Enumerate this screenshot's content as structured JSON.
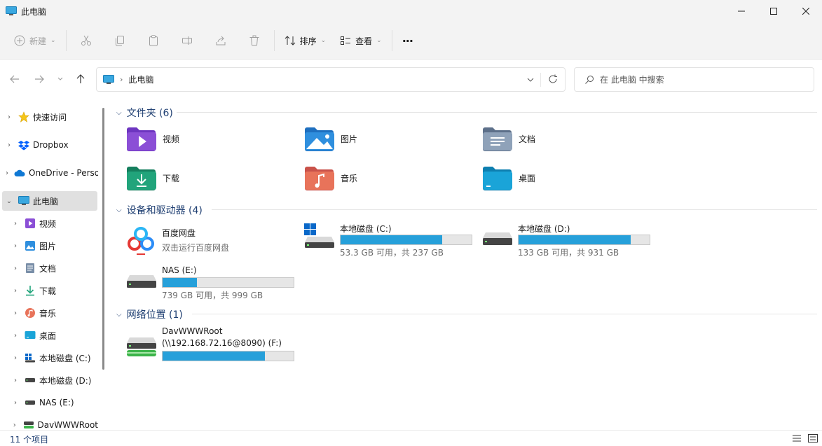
{
  "window": {
    "title": "此电脑"
  },
  "toolbar": {
    "new_label": "新建",
    "sort_label": "排序",
    "view_label": "查看",
    "more_label": "···"
  },
  "address": {
    "crumb": "此电脑",
    "search_placeholder": "在 此电脑 中搜索"
  },
  "sidebar": {
    "items": [
      {
        "label": "快速访问"
      },
      {
        "label": "Dropbox"
      },
      {
        "label": "OneDrive - Personal"
      },
      {
        "label": "此电脑"
      },
      {
        "label": "视频"
      },
      {
        "label": "图片"
      },
      {
        "label": "文档"
      },
      {
        "label": "下载"
      },
      {
        "label": "音乐"
      },
      {
        "label": "桌面"
      },
      {
        "label": "本地磁盘 (C:)"
      },
      {
        "label": "本地磁盘 (D:)"
      },
      {
        "label": "NAS (E:)"
      },
      {
        "label": "DavWWWRoot"
      }
    ]
  },
  "groups": {
    "folders": {
      "title": "文件夹 (6)"
    },
    "devices": {
      "title": "设备和驱动器 (4)"
    },
    "network": {
      "title": "网络位置 (1)"
    }
  },
  "folders": [
    {
      "name": "视频",
      "color": "#8b4fd6"
    },
    {
      "name": "图片",
      "color": "#2f8fde"
    },
    {
      "name": "文档",
      "color": "#7a8fa8"
    },
    {
      "name": "下载",
      "color": "#21a47b"
    },
    {
      "name": "音乐",
      "color": "#e8735a"
    },
    {
      "name": "桌面",
      "color": "#1aa4d8"
    }
  ],
  "baidu": {
    "name": "百度网盘",
    "subtitle": "双击运行百度网盘"
  },
  "drives": [
    {
      "name": "本地磁盘 (C:)",
      "free": "53.3 GB 可用，共 237 GB",
      "used_fraction": 0.775
    },
    {
      "name": "本地磁盘 (D:)",
      "free": "133 GB 可用，共 931 GB",
      "used_fraction": 0.857
    },
    {
      "name": "NAS (E:)",
      "free": "739 GB 可用，共 999 GB",
      "used_fraction": 0.26
    }
  ],
  "network_drive": {
    "name_line1": "DavWWWRoot",
    "name_line2": "(\\\\192.168.72.16@8090) (F:)",
    "used_fraction": 0.78
  },
  "status": {
    "count": "11 个项目"
  },
  "colors": {
    "accent": "#26a0da",
    "group_header": "#1f3f72",
    "selection": "#e0e0e0"
  }
}
